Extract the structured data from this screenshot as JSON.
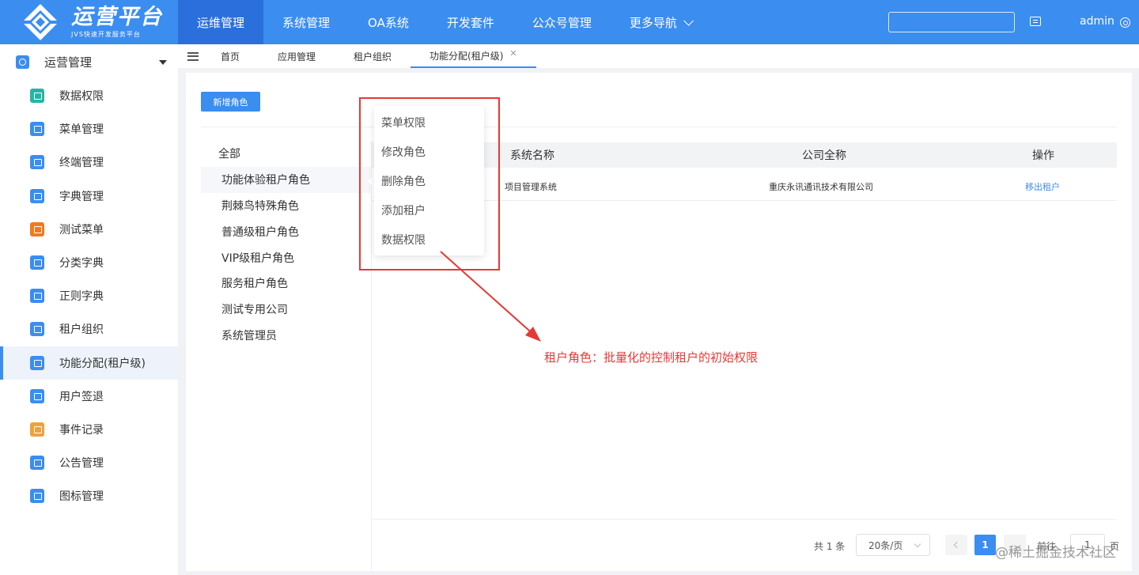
{
  "brand": {
    "title": "运营平台",
    "subtitle": "JVS快速开发服务平台"
  },
  "topnav": {
    "items": [
      {
        "label": "运维管理",
        "active": true
      },
      {
        "label": "系统管理",
        "active": false
      },
      {
        "label": "OA系统",
        "active": false
      },
      {
        "label": "开发套件",
        "active": false
      },
      {
        "label": "公众号管理",
        "active": false
      },
      {
        "label": "更多导航",
        "active": false
      }
    ],
    "search_value": "",
    "user": "admin"
  },
  "sidebar": {
    "header": "运营管理",
    "items": [
      {
        "label": "数据权限",
        "icon": "data-permission-icon",
        "color": "#26b5a5"
      },
      {
        "label": "菜单管理",
        "icon": "menu-icon",
        "color": "#3b8df0"
      },
      {
        "label": "终端管理",
        "icon": "terminal-icon",
        "color": "#3b8df0"
      },
      {
        "label": "字典管理",
        "icon": "dictionary-icon",
        "color": "#3b8df0"
      },
      {
        "label": "测试菜单",
        "icon": "test-menu-icon",
        "color": "#f07a1e"
      },
      {
        "label": "分类字典",
        "icon": "chart-icon",
        "color": "#3b8df0"
      },
      {
        "label": "正则字典",
        "icon": "regex-icon",
        "color": "#3b8df0"
      },
      {
        "label": "租户组织",
        "icon": "tenant-org-icon",
        "color": "#3b8df0"
      },
      {
        "label": "功能分配(租户级)",
        "icon": "function-assign-icon",
        "color": "#3b8df0",
        "active": true
      },
      {
        "label": "用户签退",
        "icon": "user-signout-icon",
        "color": "#3b8df0"
      },
      {
        "label": "事件记录",
        "icon": "event-log-icon",
        "color": "#f0a13b"
      },
      {
        "label": "公告管理",
        "icon": "announcement-icon",
        "color": "#3b8df0"
      },
      {
        "label": "图标管理",
        "icon": "icon-manage-icon",
        "color": "#3b8df0"
      }
    ]
  },
  "tabs": [
    {
      "label": "首页",
      "active": false
    },
    {
      "label": "应用管理",
      "active": false
    },
    {
      "label": "租户组织",
      "active": false
    },
    {
      "label": "功能分配(租户级)",
      "active": true,
      "closable": true
    }
  ],
  "main": {
    "add_role_label": "新增角色",
    "roles": [
      {
        "label": "全部"
      },
      {
        "label": "功能体验租户角色",
        "selected": true
      },
      {
        "label": "荆棘鸟特殊角色"
      },
      {
        "label": "普通级租户角色"
      },
      {
        "label": "VIP级租户角色"
      },
      {
        "label": "服务租户角色"
      },
      {
        "label": "测试专用公司"
      },
      {
        "label": "系统管理员"
      }
    ],
    "table": {
      "columns": [
        "系统名称",
        "公司全称",
        "操作"
      ],
      "rows": [
        {
          "system": "项目管理系统",
          "company": "重庆永讯通讯技术有限公司",
          "action": "移出租户"
        }
      ]
    },
    "context_menu": [
      "菜单权限",
      "修改角色",
      "删除角色",
      "添加租户",
      "数据权限"
    ],
    "pagination": {
      "total": "共 1 条",
      "page_size": "20条/页",
      "current_page": "1",
      "goto_label": "前往",
      "goto_value": "1",
      "page_suffix": "页"
    }
  },
  "annotation": {
    "text": "租户角色：批量化的控制租户的初始权限",
    "color": "#e53935"
  },
  "watermark": "@稀土掘金技术社区"
}
